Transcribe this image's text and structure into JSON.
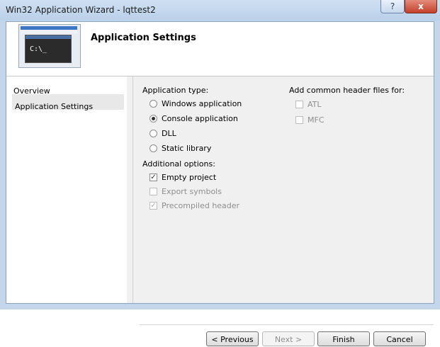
{
  "window": {
    "title": "Win32 Application Wizard - lqttest2",
    "help_label": "?",
    "close_label": "x"
  },
  "header": {
    "title": "Application Settings",
    "console_prompt": "C:\\_"
  },
  "nav": [
    {
      "label": "Overview"
    },
    {
      "label": "Application Settings"
    }
  ],
  "app_type": {
    "heading": "Application type:",
    "options": [
      {
        "label": "Windows application",
        "selected": false
      },
      {
        "label": "Console application",
        "selected": true
      },
      {
        "label": "DLL",
        "selected": false
      },
      {
        "label": "Static library",
        "selected": false
      }
    ]
  },
  "additional": {
    "heading": "Additional options:",
    "options": [
      {
        "label": "Empty project",
        "checked": true,
        "enabled": true
      },
      {
        "label": "Export symbols",
        "checked": false,
        "enabled": false
      },
      {
        "label": "Precompiled header",
        "checked": true,
        "enabled": false
      }
    ]
  },
  "headers": {
    "heading": "Add common header files for:",
    "options": [
      {
        "label": "ATL",
        "checked": false,
        "enabled": false
      },
      {
        "label": "MFC",
        "checked": false,
        "enabled": false
      }
    ]
  },
  "buttons": {
    "previous": "< Previous",
    "next": "Next >",
    "finish": "Finish",
    "cancel": "Cancel"
  }
}
